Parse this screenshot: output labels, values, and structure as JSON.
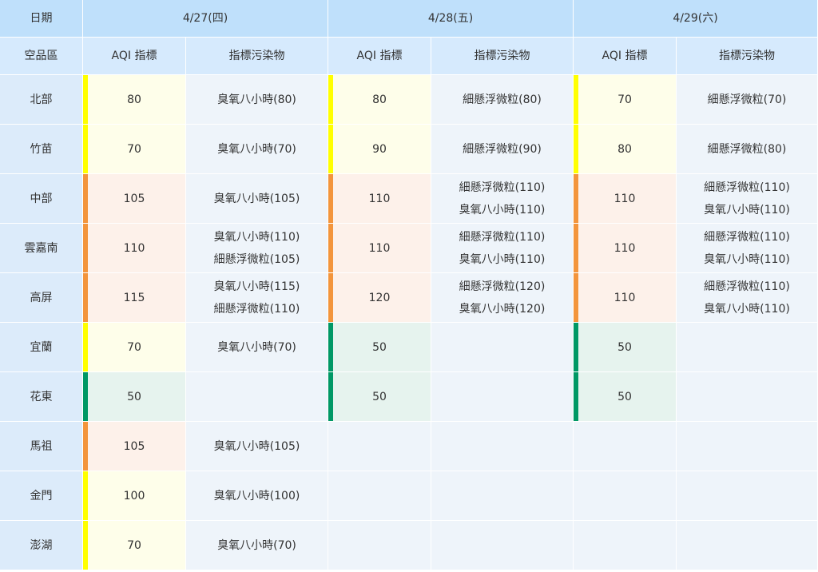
{
  "header": {
    "date_label": "日期",
    "region_label": "空品區",
    "aqi_label": "AQI 指標",
    "pollutant_label": "指標污染物",
    "days": [
      "4/27(四)",
      "4/28(五)",
      "4/29(六)"
    ]
  },
  "colors": {
    "moderate": "#ffff00",
    "unhealthy_sensitive": "#f3953c",
    "good": "#009865",
    "header_bg": "#bfe0fb"
  },
  "rows": [
    {
      "region": "北部",
      "days": [
        {
          "aqi": "80",
          "level": "moderate",
          "pollutants": [
            "臭氧八小時(80)"
          ]
        },
        {
          "aqi": "80",
          "level": "moderate",
          "pollutants": [
            "細懸浮微粒(80)"
          ]
        },
        {
          "aqi": "70",
          "level": "moderate",
          "pollutants": [
            "細懸浮微粒(70)"
          ]
        }
      ]
    },
    {
      "region": "竹苗",
      "days": [
        {
          "aqi": "70",
          "level": "moderate",
          "pollutants": [
            "臭氧八小時(70)"
          ]
        },
        {
          "aqi": "90",
          "level": "moderate",
          "pollutants": [
            "細懸浮微粒(90)"
          ]
        },
        {
          "aqi": "80",
          "level": "moderate",
          "pollutants": [
            "細懸浮微粒(80)"
          ]
        }
      ]
    },
    {
      "region": "中部",
      "days": [
        {
          "aqi": "105",
          "level": "usg",
          "pollutants": [
            "臭氧八小時(105)"
          ]
        },
        {
          "aqi": "110",
          "level": "usg",
          "pollutants": [
            "細懸浮微粒(110)",
            "臭氧八小時(110)"
          ]
        },
        {
          "aqi": "110",
          "level": "usg",
          "pollutants": [
            "細懸浮微粒(110)",
            "臭氧八小時(110)"
          ]
        }
      ]
    },
    {
      "region": "雲嘉南",
      "days": [
        {
          "aqi": "110",
          "level": "usg",
          "pollutants": [
            "臭氧八小時(110)",
            "細懸浮微粒(105)"
          ]
        },
        {
          "aqi": "110",
          "level": "usg",
          "pollutants": [
            "細懸浮微粒(110)",
            "臭氧八小時(110)"
          ]
        },
        {
          "aqi": "110",
          "level": "usg",
          "pollutants": [
            "細懸浮微粒(110)",
            "臭氧八小時(110)"
          ]
        }
      ]
    },
    {
      "region": "高屏",
      "days": [
        {
          "aqi": "115",
          "level": "usg",
          "pollutants": [
            "臭氧八小時(115)",
            "細懸浮微粒(110)"
          ]
        },
        {
          "aqi": "120",
          "level": "usg",
          "pollutants": [
            "細懸浮微粒(120)",
            "臭氧八小時(120)"
          ]
        },
        {
          "aqi": "110",
          "level": "usg",
          "pollutants": [
            "細懸浮微粒(110)",
            "臭氧八小時(110)"
          ]
        }
      ]
    },
    {
      "region": "宜蘭",
      "days": [
        {
          "aqi": "70",
          "level": "moderate",
          "pollutants": [
            "臭氧八小時(70)"
          ]
        },
        {
          "aqi": "50",
          "level": "good",
          "pollutants": []
        },
        {
          "aqi": "50",
          "level": "good",
          "pollutants": []
        }
      ]
    },
    {
      "region": "花東",
      "days": [
        {
          "aqi": "50",
          "level": "good",
          "pollutants": []
        },
        {
          "aqi": "50",
          "level": "good",
          "pollutants": []
        },
        {
          "aqi": "50",
          "level": "good",
          "pollutants": []
        }
      ]
    },
    {
      "region": "馬祖",
      "days": [
        {
          "aqi": "105",
          "level": "usg",
          "pollutants": [
            "臭氧八小時(105)"
          ]
        },
        null,
        null
      ]
    },
    {
      "region": "金門",
      "days": [
        {
          "aqi": "100",
          "level": "moderate",
          "pollutants": [
            "臭氧八小時(100)"
          ]
        },
        null,
        null
      ]
    },
    {
      "region": "澎湖",
      "days": [
        {
          "aqi": "70",
          "level": "moderate",
          "pollutants": [
            "臭氧八小時(70)"
          ]
        },
        null,
        null
      ]
    }
  ]
}
